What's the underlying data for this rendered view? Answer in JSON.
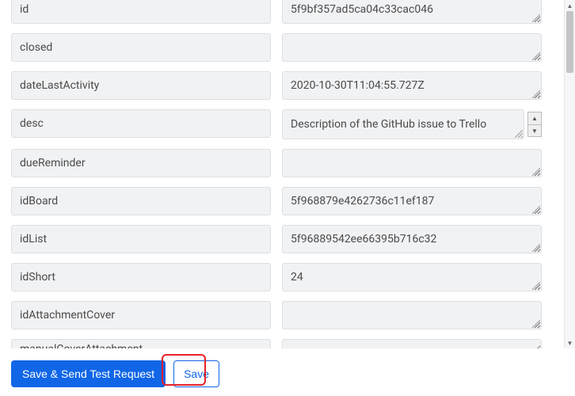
{
  "rows": [
    {
      "key": "id",
      "value": "5f9bf357ad5ca04c33cac046"
    },
    {
      "key": "closed",
      "value": ""
    },
    {
      "key": "dateLastActivity",
      "value": "2020-10-30T11:04:55.727Z"
    },
    {
      "key": "desc",
      "value": "Description of the GitHub issue to Trello"
    },
    {
      "key": "dueReminder",
      "value": ""
    },
    {
      "key": "idBoard",
      "value": "5f968879e4262736c11ef187"
    },
    {
      "key": "idList",
      "value": "5f96889542ee66395b716c32"
    },
    {
      "key": "idShort",
      "value": "24"
    },
    {
      "key": "idAttachmentCover",
      "value": ""
    },
    {
      "key": "manualCoverAttachment",
      "value": ""
    }
  ],
  "footer": {
    "save_send_label": "Save & Send Test Request",
    "save_label": "Save"
  }
}
